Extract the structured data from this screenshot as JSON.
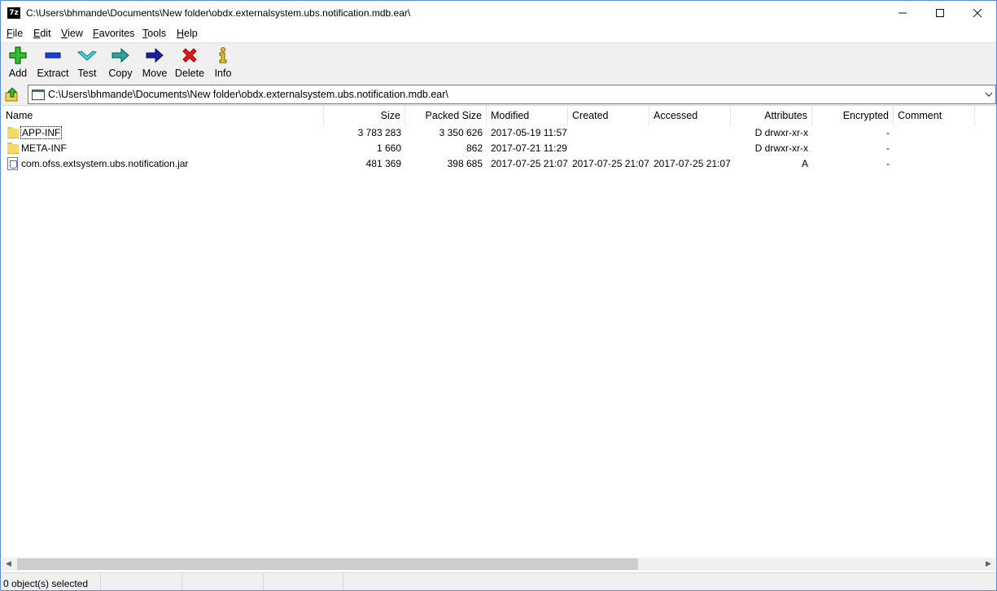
{
  "window": {
    "app_icon_label": "7z",
    "title": "C:\\Users\\bhmande\\Documents\\New folder\\obdx.externalsystem.ubs.notification.mdb.ear\\",
    "min_glyph": "—",
    "max_glyph": "☐",
    "close_glyph": "✕"
  },
  "menu": [
    {
      "accel": "F",
      "rest": "ile"
    },
    {
      "accel": "E",
      "rest": "dit"
    },
    {
      "accel": "V",
      "rest": "iew"
    },
    {
      "accel": "F",
      "rest": "avorites",
      "prefix": ""
    },
    {
      "accel": "T",
      "rest": "ools"
    },
    {
      "accel": "H",
      "rest": "elp"
    }
  ],
  "toolbar": [
    {
      "label": "Add",
      "icon": "add-icon"
    },
    {
      "label": "Extract",
      "icon": "extract-icon"
    },
    {
      "label": "Test",
      "icon": "test-icon"
    },
    {
      "label": "Copy",
      "icon": "copy-icon"
    },
    {
      "label": "Move",
      "icon": "move-icon"
    },
    {
      "label": "Delete",
      "icon": "delete-icon"
    },
    {
      "label": "Info",
      "icon": "info-icon"
    }
  ],
  "address": {
    "path": "C:\\Users\\bhmande\\Documents\\New folder\\obdx.externalsystem.ubs.notification.mdb.ear\\"
  },
  "columns": [
    "Name",
    "Size",
    "Packed Size",
    "Modified",
    "Created",
    "Accessed",
    "Attributes",
    "Encrypted",
    "Comment"
  ],
  "rows": [
    {
      "type": "folder",
      "name": "APP-INF",
      "size": "3 783 283",
      "packed": "3 350 626",
      "modified": "2017-05-19 11:57",
      "created": "",
      "accessed": "",
      "attributes": "D drwxr-xr-x",
      "encrypted": "-",
      "comment": ""
    },
    {
      "type": "folder",
      "name": "META-INF",
      "size": "1 660",
      "packed": "862",
      "modified": "2017-07-21 11:29",
      "created": "",
      "accessed": "",
      "attributes": "D drwxr-xr-x",
      "encrypted": "-",
      "comment": ""
    },
    {
      "type": "jar",
      "name": "com.ofss.extsystem.ubs.notification.jar",
      "size": "481 369",
      "packed": "398 685",
      "modified": "2017-07-25 21:07",
      "created": "2017-07-25 21:07",
      "accessed": "2017-07-25 21:07",
      "attributes": "A",
      "encrypted": "-",
      "comment": ""
    }
  ],
  "scrollbar": {
    "left_glyph": "◀",
    "right_glyph": "▶"
  },
  "status": {
    "text": "0 object(s) selected"
  }
}
